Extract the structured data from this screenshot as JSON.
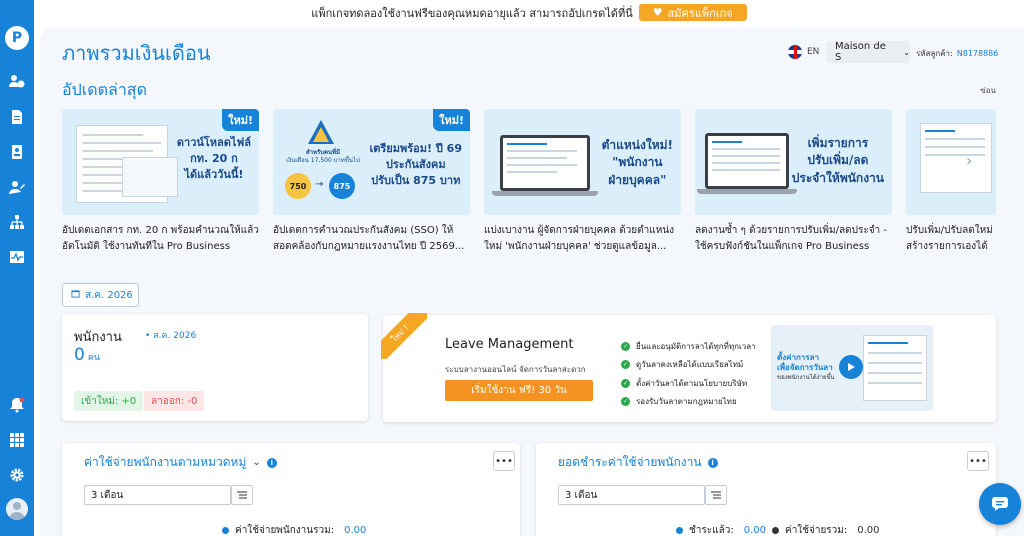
{
  "banner": {
    "message": "แพ็กเกจทดลองใช้งานฟรีของคุณหมดอายุแล้ว สามารถอัปเกรดได้ที่นี่",
    "subscribe_label": "สมัครแพ็กเกจ"
  },
  "sidebar": {
    "logo": "P",
    "items": [
      "users-clock",
      "document",
      "id-card",
      "user-edit",
      "org-chart",
      "pulse"
    ],
    "bottom": [
      "bell",
      "apps-grid",
      "settings",
      "profile"
    ]
  },
  "header": {
    "title": "ภาพรวมเงินเดือน",
    "language": "EN",
    "company": "Maison de S",
    "customer_id_label": "รหัสลูกค้า:",
    "customer_id": "N8178886"
  },
  "updates": {
    "title": "อัปเดตล่าสุด",
    "hide_label": "ซ่อน",
    "cards": [
      {
        "badge": "ใหม่!",
        "thumb_lines": [
          "ดาวน์โหลดไฟล์",
          "กท. 20 ก",
          "ได้แล้ววันนี้!"
        ],
        "caption": "อัปเดตเอกสาร กท. 20 ก พร้อมคำนวณให้แล้ว อัตโนมัติ ใช้งานทันทีใน Pro Business"
      },
      {
        "badge": "ใหม่!",
        "thumb_lines": [
          "เตรียมพร้อม! ปี 69",
          "ประกันสังคม",
          "ปรับเป็น 875 บาท"
        ],
        "thumb_small": [
          "สำหรับคนที่มี",
          "เงินเดือน 17,500 บาทขึ้นไป",
          "750",
          "875"
        ],
        "caption": "อัปเดตการคำนวณประกันสังคม (SSO) ให้สอดคล้องกับกฎหมายแรงงานไทย ปี 2569..."
      },
      {
        "thumb_lines": [
          "ตำแหน่งใหม่!",
          "\"พนักงาน",
          "ฝ่ายบุคคล\""
        ],
        "caption": "แบ่งเบางาน ผู้จัดการฝ่ายบุคคล ด้วยตำแหน่งใหม่ 'พนักงานฝ่ายบุคคล' ช่วยดูแลข้อมูล..."
      },
      {
        "thumb_lines": [
          "เพิ่มรายการ",
          "ปรับเพิ่ม/ลด",
          "ประจำให้พนักงาน"
        ],
        "caption": "ลดงานซ้ำ ๆ ด้วยรายการปรับเพิ่ม/ลดประจำ - ใช้ครบฟังก์ชันในแพ็กเกจ Pro Business"
      },
      {
        "caption": "ปรับเพิ่ม/ปรับลดใหม่ สร้างรายการเองได้"
      }
    ]
  },
  "date_filter": "ส.ค. 2026",
  "employees": {
    "title": "พนักงาน",
    "month": "ส.ค. 2026",
    "count": "0",
    "unit": "คน",
    "new_label": "เข้าใหม่: +0",
    "left_label": "ลาออก: -0"
  },
  "promo": {
    "ribbon": "ใหม่ !",
    "title": "Leave Management",
    "subtitle": "ระบบลางานออนไลน์ จัดการวันลาสะดวก",
    "cta": "เริ่มใช้งาน ฟรี! 30 วัน",
    "features": [
      "ยื่นและอนุมัติการลาได้ทุกที่ทุกเวลา",
      "ดูวันลาคงเหลือได้แบบเรียลไทม์",
      "ตั้งค่าวันลาได้ตามนโยบายบริษัท",
      "รองรับวันลาตามกฎหมายไทย"
    ],
    "video_text": [
      "ตั้งค่าการลา",
      "เพื่อจัดการวันลา",
      "ของพนักงานได้ง่ายขึ้น"
    ]
  },
  "expense_by_category": {
    "title": "ค่าใช้จ่ายพนักงานตามหมวดหมู่",
    "period": "3 เดือน",
    "total_label": "ค่าใช้จ่ายพนักงานรวม:",
    "total_value": "0.00"
  },
  "payment_summary": {
    "title": "ยอดชำระค่าใช้จ่ายพนักงาน",
    "period": "3 เดือน",
    "paid_label": "ชำระแล้ว:",
    "paid_value": "0.00",
    "total_label": "ค่าใช้จ่ายรวม:",
    "total_value": "0.00"
  },
  "colors": {
    "primary": "#1682d8",
    "accent": "#f5a623",
    "success": "#2aa84a",
    "danger": "#e05050"
  }
}
